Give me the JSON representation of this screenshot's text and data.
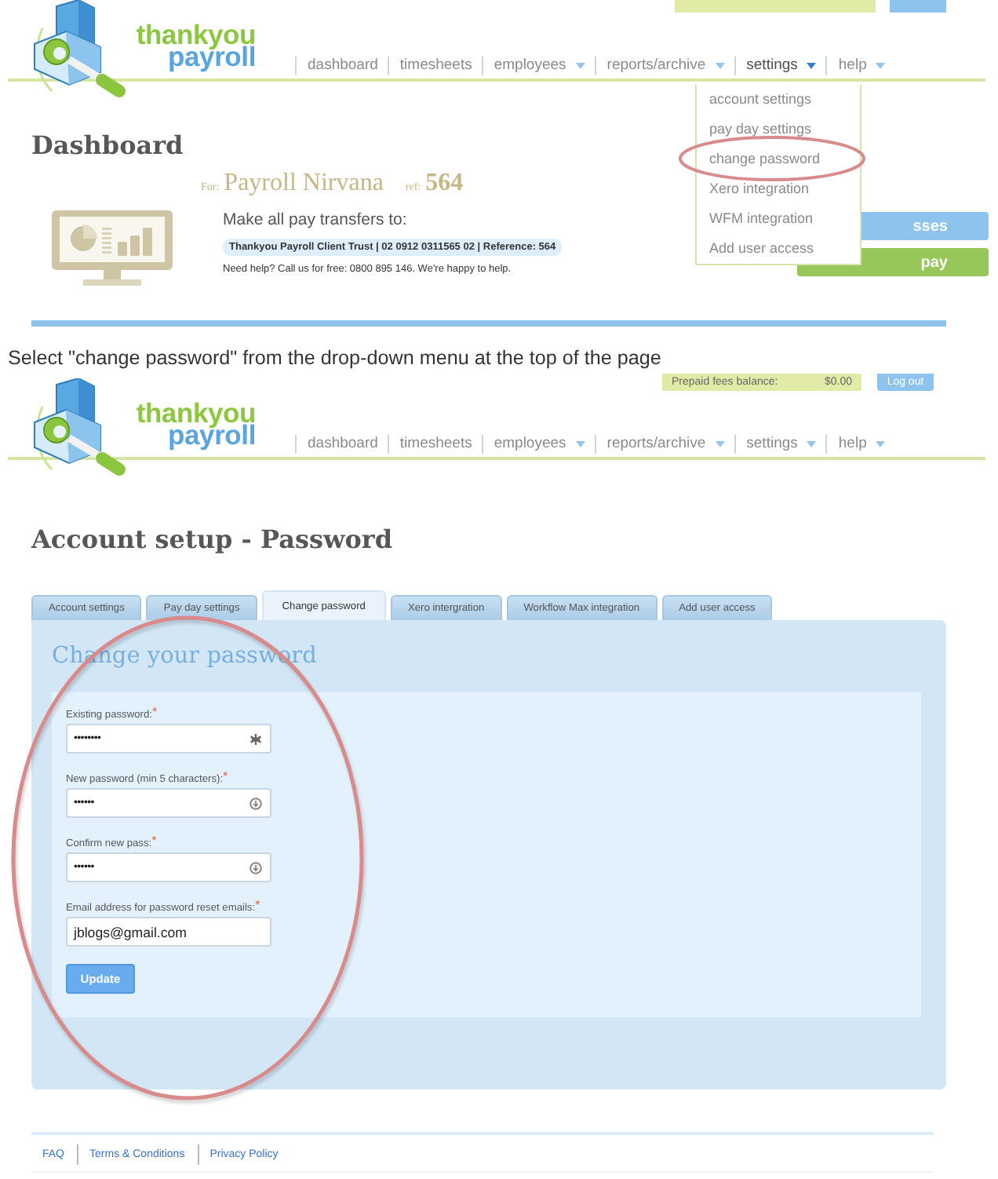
{
  "dashboard_screen": {
    "header": {
      "logo": {
        "lines": [
          "thankyou",
          "payroll"
        ]
      },
      "nav": [
        {
          "label": "dashboard",
          "has_menu": false,
          "open": false
        },
        {
          "label": "timesheets",
          "has_menu": false,
          "open": false
        },
        {
          "label": "employees",
          "has_menu": true,
          "open": false
        },
        {
          "label": "reports/archive",
          "has_menu": true,
          "open": false
        },
        {
          "label": "settings",
          "has_menu": true,
          "open": true
        },
        {
          "label": "help",
          "has_menu": true,
          "open": false
        }
      ]
    },
    "settings_menu": {
      "items": [
        {
          "label": "account settings",
          "circled": false
        },
        {
          "label": "pay day settings",
          "circled": false
        },
        {
          "label": "change password",
          "circled": true
        },
        {
          "label": "Xero integration",
          "circled": false
        },
        {
          "label": "WFM integration",
          "circled": false
        },
        {
          "label": "Add user access",
          "circled": false
        }
      ]
    },
    "title": "Dashboard",
    "client": {
      "for_label": "For:",
      "name": "Payroll Nirvana",
      "ref_label": "ref:",
      "ref": "564"
    },
    "transfer": {
      "heading": "Make all pay transfers to:",
      "account": "Thankyou Payroll Client Trust | 02 0912 0311565 02 | Reference: 564",
      "help": "Need help? Call us for free: 0800 895 146. We're happy to help."
    },
    "actions": [
      {
        "label": "sses",
        "kind": "secondary"
      },
      {
        "label": "pay",
        "kind": "primary"
      }
    ]
  },
  "caption": "Select \"change password\" from the drop-down menu at the top of the page",
  "password_screen": {
    "header": {
      "balance": {
        "label": "Prepaid fees balance:",
        "amount": "$0.00"
      },
      "logout": "Log out",
      "logo": {
        "lines": [
          "thankyou",
          "payroll"
        ]
      },
      "nav": [
        {
          "label": "dashboard",
          "has_menu": false,
          "open": false
        },
        {
          "label": "timesheets",
          "has_menu": false,
          "open": false
        },
        {
          "label": "employees",
          "has_menu": true,
          "open": false
        },
        {
          "label": "reports/archive",
          "has_menu": true,
          "open": false
        },
        {
          "label": "settings",
          "has_menu": true,
          "open": false
        },
        {
          "label": "help",
          "has_menu": true,
          "open": false
        }
      ]
    },
    "title": "Account setup - Password",
    "tabs": [
      {
        "label": "Account settings",
        "selected": false
      },
      {
        "label": "Pay day settings",
        "selected": false
      },
      {
        "label": "Change password",
        "selected": true
      },
      {
        "label": "Xero intergration",
        "selected": false
      },
      {
        "label": "Workflow Max integration",
        "selected": false
      },
      {
        "label": "Add user access",
        "selected": false
      }
    ],
    "form": {
      "heading": "Change your password",
      "circled": true,
      "fields": [
        {
          "label": "Existing password:",
          "required_mark": "*",
          "kind": "existing_password",
          "value": "••••••••"
        },
        {
          "label": "New password (min 5 characters):",
          "required_mark": "*",
          "kind": "new_password",
          "value": "••••••"
        },
        {
          "label": "Confirm new pass:",
          "required_mark": "*",
          "kind": "new_password",
          "value": "••••••"
        },
        {
          "label": "Email address for password reset emails:",
          "required_mark": "*",
          "kind": "email",
          "value": "jblogs@gmail.com"
        }
      ],
      "submit": "Update"
    },
    "footer": {
      "links": [
        "FAQ",
        "Terms & Conditions",
        "Privacy Policy"
      ]
    }
  }
}
